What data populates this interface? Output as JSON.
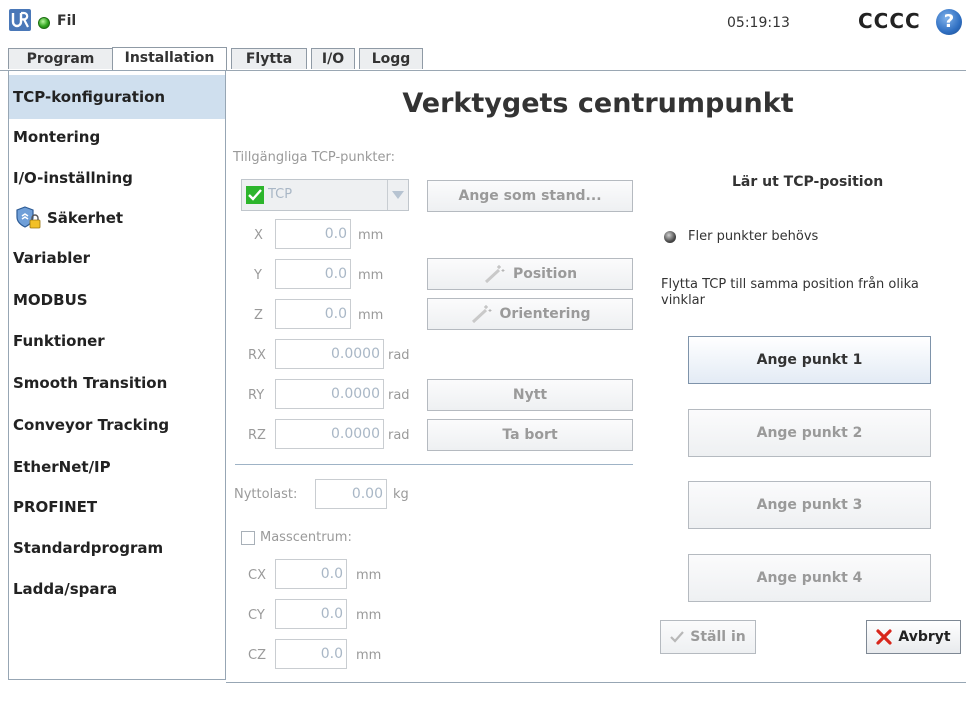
{
  "header": {
    "menu_label": "Fil",
    "clock": "05:19:13",
    "robot_name": "CCCC",
    "help_glyph": "?",
    "status_color": "#2fa51e"
  },
  "tabs": {
    "primary": [
      {
        "label": "Program",
        "active": false
      },
      {
        "label": "Installation",
        "active": true
      }
    ],
    "secondary": [
      {
        "label": "Flytta"
      },
      {
        "label": "I/O"
      },
      {
        "label": "Logg"
      }
    ]
  },
  "sidebar": {
    "items": [
      {
        "label": "TCP-konfiguration",
        "selected": true
      },
      {
        "label": "Montering"
      },
      {
        "label": "I/O-inställning"
      },
      {
        "label": "Säkerhet",
        "icon": "shield-lock-icon"
      },
      {
        "label": "Variabler"
      },
      {
        "label": "MODBUS"
      },
      {
        "label": "Funktioner"
      },
      {
        "label": "Smooth Transition"
      },
      {
        "label": "Conveyor Tracking"
      },
      {
        "label": "EtherNet/IP"
      },
      {
        "label": "PROFINET"
      },
      {
        "label": "Standardprogram"
      },
      {
        "label": "Ladda/spara"
      }
    ]
  },
  "main": {
    "title": "Verktygets centrumpunkt",
    "available_label": "Tillgängliga TCP-punkter:",
    "tcp_selected": "TCP",
    "set_default_label": "Ange som stand...",
    "coords": [
      {
        "label": "X",
        "value": "0.0",
        "unit": "mm"
      },
      {
        "label": "Y",
        "value": "0.0",
        "unit": "mm"
      },
      {
        "label": "Z",
        "value": "0.0",
        "unit": "mm"
      },
      {
        "label": "RX",
        "value": "0.0000",
        "unit": "rad"
      },
      {
        "label": "RY",
        "value": "0.0000",
        "unit": "rad"
      },
      {
        "label": "RZ",
        "value": "0.0000",
        "unit": "rad"
      }
    ],
    "position_btn": "Position",
    "orientation_btn": "Orientering",
    "new_btn": "Nytt",
    "delete_btn": "Ta bort",
    "payload_label": "Nyttolast:",
    "payload_value": "0.00",
    "payload_unit": "kg",
    "cog_label": "Masscentrum:",
    "cog": [
      {
        "label": "CX",
        "value": "0.0",
        "unit": "mm"
      },
      {
        "label": "CY",
        "value": "0.0",
        "unit": "mm"
      },
      {
        "label": "CZ",
        "value": "0.0",
        "unit": "mm"
      }
    ]
  },
  "teach": {
    "heading": "Lär ut TCP-position",
    "status": "Fler punkter behövs",
    "instruction": "Flytta TCP till samma position från olika vinklar",
    "points": [
      "Ange punkt 1",
      "Ange punkt 2",
      "Ange punkt 3",
      "Ange punkt 4"
    ],
    "set_btn": "Ställ in",
    "cancel_btn": "Avbryt"
  }
}
